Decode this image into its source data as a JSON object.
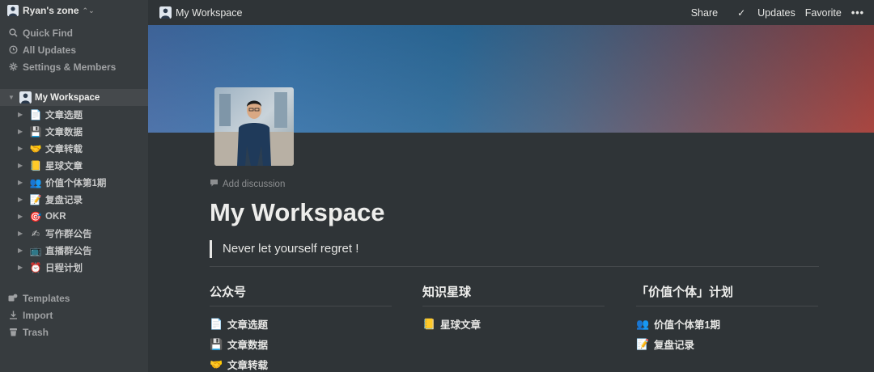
{
  "workspace": {
    "name": "Ryan's zone"
  },
  "nav": [
    {
      "label": "Quick Find",
      "icon": "search-icon"
    },
    {
      "label": "All Updates",
      "icon": "clock-icon"
    },
    {
      "label": "Settings & Members",
      "icon": "gear-icon"
    }
  ],
  "tree": {
    "root": {
      "label": "My Workspace"
    },
    "children": [
      {
        "label": "文章选题",
        "emoji": "📄"
      },
      {
        "label": "文章数据",
        "emoji": "💾"
      },
      {
        "label": "文章转载",
        "emoji": "🤝"
      },
      {
        "label": "星球文章",
        "emoji": "📒"
      },
      {
        "label": "价值个体第1期",
        "emoji": "👥"
      },
      {
        "label": "复盘记录",
        "emoji": "📝"
      },
      {
        "label": "OKR",
        "emoji": "🎯"
      },
      {
        "label": "写作群公告",
        "emoji": "✍"
      },
      {
        "label": "直播群公告",
        "emoji": "📺"
      },
      {
        "label": "日程计划",
        "emoji": "⏰"
      }
    ]
  },
  "bottom_nav": [
    {
      "label": "Templates",
      "icon": "templates-icon"
    },
    {
      "label": "Import",
      "icon": "import-icon"
    },
    {
      "label": "Trash",
      "icon": "trash-icon"
    }
  ],
  "topbar": {
    "breadcrumb": "My Workspace",
    "share": "Share",
    "updates": "Updates",
    "favorite": "Favorite",
    "more": "•••"
  },
  "page": {
    "add_discussion": "Add discussion",
    "title": "My Workspace",
    "quote": "Never let yourself regret !"
  },
  "columns": [
    {
      "heading": "公众号",
      "items": [
        {
          "label": "文章选题",
          "emoji": "📄"
        },
        {
          "label": "文章数据",
          "emoji": "💾"
        },
        {
          "label": "文章转载",
          "emoji": "🤝"
        }
      ]
    },
    {
      "heading": "知识星球",
      "items": [
        {
          "label": "星球文章",
          "emoji": "📒"
        }
      ]
    },
    {
      "heading": "「价值个体」计划",
      "items": [
        {
          "label": "价值个体第1期",
          "emoji": "👥"
        },
        {
          "label": "复盘记录",
          "emoji": "📝"
        }
      ]
    }
  ]
}
